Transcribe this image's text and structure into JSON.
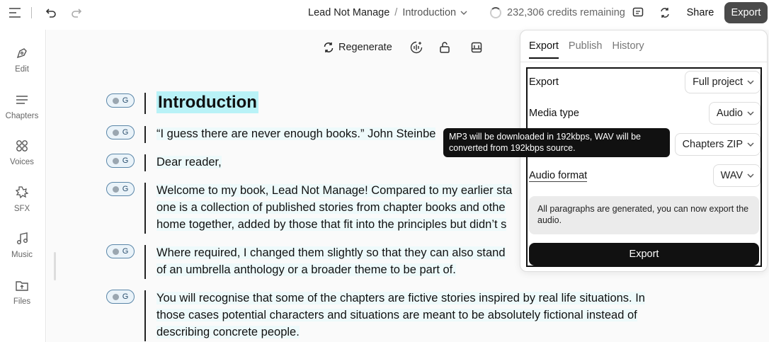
{
  "topbar": {
    "project": "Lead Not Manage",
    "separator": "/",
    "chapter": "Introduction",
    "credits": "232,306 credits remaining",
    "share": "Share",
    "export": "Export"
  },
  "sidebar": {
    "items": [
      {
        "label": "Edit",
        "icon": "pen-tool-icon"
      },
      {
        "label": "Chapters",
        "icon": "list-icon"
      },
      {
        "label": "Voices",
        "icon": "voices-grid-icon"
      },
      {
        "label": "SFX",
        "icon": "burst-icon"
      },
      {
        "label": "Music",
        "icon": "music-note-icon"
      },
      {
        "label": "Files",
        "icon": "folder-upload-icon"
      }
    ]
  },
  "toolbar": {
    "regenerate": "Regenerate"
  },
  "document": {
    "badge_label": "G",
    "heading": "Introduction",
    "paragraphs": [
      [
        "“I guess there are never enough books.” John Steinbe"
      ],
      [
        "Dear reader,"
      ],
      [
        "Welcome to my book, Lead Not Manage! Compared to my earlier sta",
        "one is a collection of published stories from chapter books and othe",
        "home together, added by those that fit into the principles but didn’t s"
      ],
      [
        "Where required, I changed them slightly so that they can also stand",
        "of an umbrella anthology or a broader theme to be part of."
      ],
      [
        "You will recognise that some of the chapters are fictive stories inspired by real life situations. In",
        "those cases potential characters and situations are meant to be absolutely fictional instead of",
        "describing concrete people."
      ]
    ]
  },
  "export_panel": {
    "tabs": [
      "Export",
      "Publish",
      "History"
    ],
    "active_tab": "Export",
    "rows": [
      {
        "label": "Export",
        "value": "Full project"
      },
      {
        "label": "Media type",
        "value": "Audio"
      },
      {
        "label": "",
        "value": "Chapters ZIP"
      },
      {
        "label": "Audio format",
        "value": "WAV"
      }
    ],
    "notice": "All paragraphs are generated, you can now export the audio.",
    "export_button": "Export",
    "tooltip": "MP3 will be downloaded in 192kbps, WAV will be converted from 192kbps source."
  }
}
